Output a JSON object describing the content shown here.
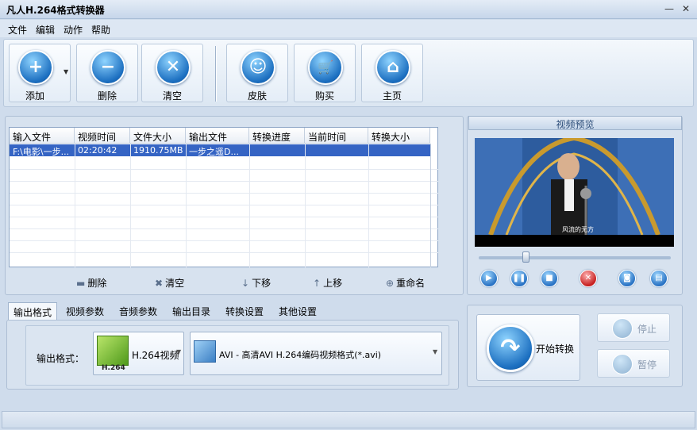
{
  "app": {
    "title": "凡人H.264格式转换器"
  },
  "window_controls": {
    "minimize": "—",
    "close": "✕"
  },
  "menu": [
    "文件",
    "编辑",
    "动作",
    "帮助"
  ],
  "toolbar": {
    "add": "添加",
    "delete": "删除",
    "clear": "清空",
    "skin": "皮肤",
    "buy": "购买",
    "home": "主页"
  },
  "table": {
    "headers": [
      "输入文件",
      "视频时间",
      "文件大小",
      "输出文件",
      "转换进度",
      "当前时间",
      "转换大小"
    ],
    "rows": [
      [
        "F:\\电影\\一步...",
        "02:20:42",
        "1910.75MB",
        "一步之遥D...",
        "",
        "",
        ""
      ]
    ]
  },
  "list_actions": {
    "delete": "删除",
    "clear": "清空",
    "down": "下移",
    "up": "上移",
    "rename": "重命名"
  },
  "tabs": [
    "输出格式",
    "视频参数",
    "音频参数",
    "输出目录",
    "转换设置",
    "其他设置"
  ],
  "output": {
    "label": "输出格式：",
    "category": "H.264视频",
    "category_badge": "H.264",
    "format": "AVI - 高清AVI H.264编码视频格式(*.avi)"
  },
  "preview": {
    "title": "视频预览",
    "subtitle": "风流的无方"
  },
  "convert": {
    "start": "开始转换",
    "stop": "停止",
    "pause": "暂停"
  },
  "icons": {
    "add": "plus-icon",
    "delete": "minus-icon",
    "clear": "x-icon",
    "skin": "smiley-icon",
    "buy": "cart-icon",
    "home": "house-icon"
  }
}
